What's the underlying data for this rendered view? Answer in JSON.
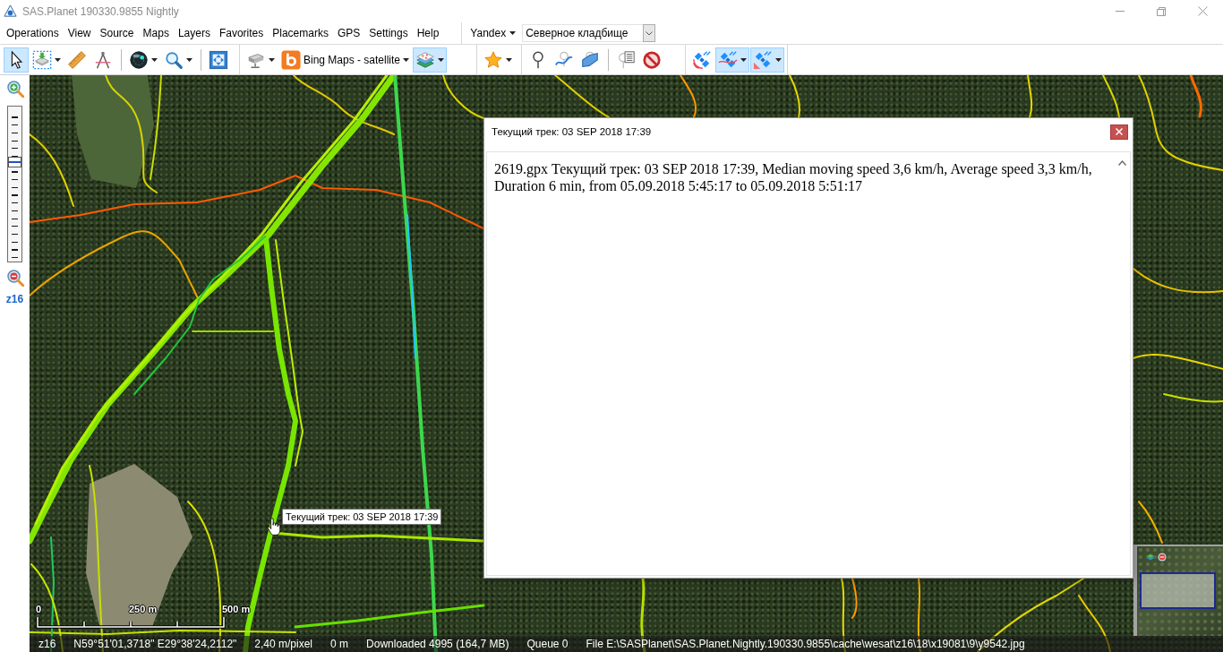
{
  "window": {
    "title": "SAS.Planet 190330.9855 Nightly"
  },
  "menu": [
    {
      "label": "Operations"
    },
    {
      "label": "View"
    },
    {
      "label": "Source"
    },
    {
      "label": "Maps"
    },
    {
      "label": "Layers"
    },
    {
      "label": "Favorites"
    },
    {
      "label": "Placemarks"
    },
    {
      "label": "GPS"
    },
    {
      "label": "Settings"
    },
    {
      "label": "Help"
    }
  ],
  "search": {
    "provider": "Yandex",
    "value": "Северное кладбище"
  },
  "toolbar": [
    {
      "groups": [
        [
          {
            "kind": "tool",
            "selected": true,
            "dropdown": false
          },
          {
            "kind": "tool",
            "selected": false,
            "dropdown": true
          },
          {
            "kind": "tool",
            "selected": false,
            "dropdown": false
          },
          {
            "kind": "tool",
            "selected": false,
            "dropdown": false
          }
        ],
        [
          {
            "kind": "tool",
            "selected": false,
            "dropdown": true
          },
          {
            "kind": "tool",
            "selected": false,
            "dropdown": true
          }
        ],
        [
          {
            "kind": "tool",
            "selected": false,
            "dropdown": false
          }
        ]
      ]
    },
    {
      "groups": [
        [
          {
            "kind": "tool",
            "selected": false,
            "dropdown": true
          },
          {
            "kind": "source",
            "label": "Bing Maps - satellite",
            "selected": false,
            "dropdown": true
          },
          {
            "kind": "tool",
            "selected": true,
            "dropdown": true
          }
        ]
      ]
    },
    {
      "groups": [
        [
          {
            "kind": "tool",
            "selected": false,
            "dropdown": true
          }
        ]
      ]
    },
    {
      "groups": [
        [
          {
            "kind": "tool",
            "selected": false,
            "dropdown": false
          },
          {
            "kind": "tool",
            "selected": false,
            "dropdown": false
          },
          {
            "kind": "tool",
            "selected": false,
            "dropdown": false
          }
        ],
        [
          {
            "kind": "tool",
            "selected": false,
            "dropdown": false
          },
          {
            "kind": "tool",
            "selected": false,
            "dropdown": false
          }
        ]
      ]
    },
    {
      "groups": [
        [
          {
            "kind": "tool",
            "selected": false,
            "dropdown": false
          },
          {
            "kind": "tool",
            "selected": true,
            "dropdown": true
          },
          {
            "kind": "tool",
            "selected": true,
            "dropdown": true
          }
        ]
      ]
    }
  ],
  "zoom": {
    "level": 0.64,
    "label": "z16"
  },
  "map": {
    "tooltip": "Текущий трек: 03 SEP 2018 17:39",
    "scale": [
      "0",
      "250 m",
      "500 m"
    ]
  },
  "dialog": {
    "title": "Текущий трек: 03 SEP 2018 17:39",
    "text": "2619.gpx Текущий трек: 03 SEP 2018 17:39, Median moving speed 3,6 km/h, Average speed 3,3 km/h, Duration 6 min, from 05.09.2018 5:45:17 to 05.09.2018 5:51:17"
  },
  "status_bar": [
    "z16",
    "N59°51'01,3718\" E29°38'24,2112\"",
    "2,40 m/pixel",
    "0 m",
    "Downloaded 4995 (164,7 MB)",
    "Queue 0",
    "File E:\\SASPlanet\\SAS.Planet.Nightly.190330.9855\\cache\\wesat\\z16\\18\\x19081\\9\\y9542.jpg"
  ]
}
